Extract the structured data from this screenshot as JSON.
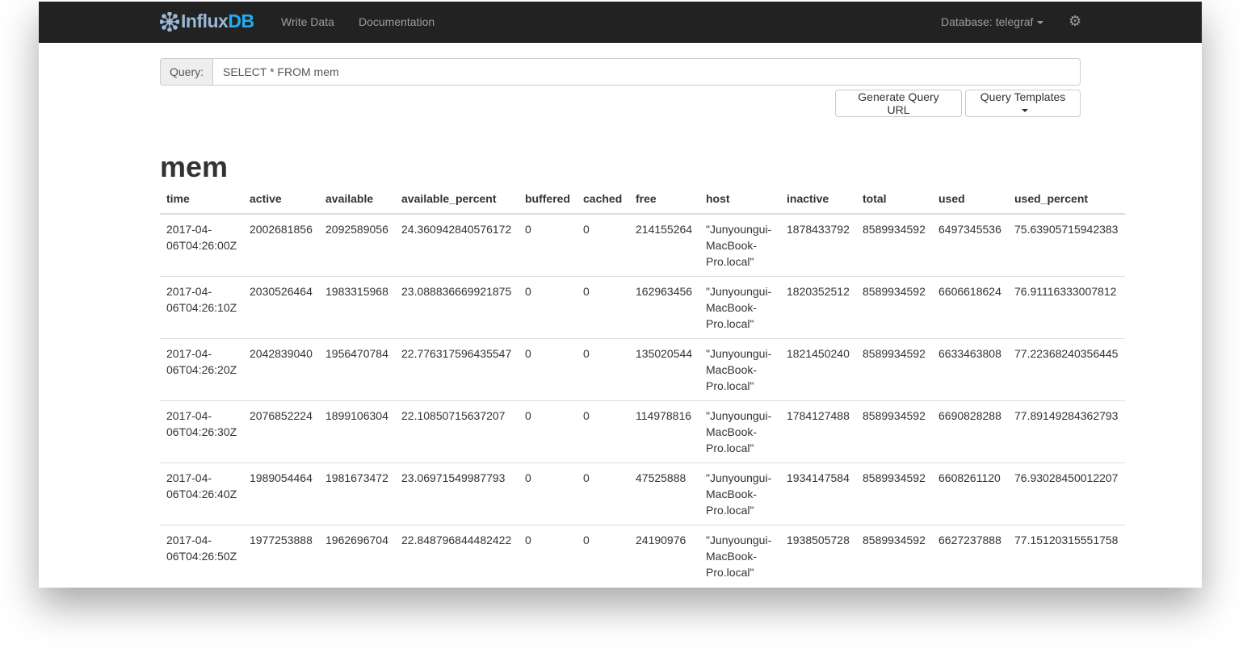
{
  "navbar": {
    "brand_a": "Influx",
    "brand_b": "DB",
    "links": [
      "Write Data",
      "Documentation"
    ],
    "database_label": "Database: telegraf",
    "settings_icon": "gear-icon"
  },
  "query": {
    "label": "Query:",
    "value": "SELECT * FROM mem"
  },
  "buttons": {
    "generate_url": "Generate Query URL",
    "templates": "Query Templates"
  },
  "result": {
    "title": "mem",
    "columns": [
      "time",
      "active",
      "available",
      "available_percent",
      "buffered",
      "cached",
      "free",
      "host",
      "inactive",
      "total",
      "used",
      "used_percent"
    ],
    "rows": [
      [
        "2017-04-06T04:26:00Z",
        "2002681856",
        "2092589056",
        "24.360942840576172",
        "0",
        "0",
        "214155264",
        "\"Junyoungui-MacBook-Pro.local\"",
        "1878433792",
        "8589934592",
        "6497345536",
        "75.63905715942383"
      ],
      [
        "2017-04-06T04:26:10Z",
        "2030526464",
        "1983315968",
        "23.088836669921875",
        "0",
        "0",
        "162963456",
        "\"Junyoungui-MacBook-Pro.local\"",
        "1820352512",
        "8589934592",
        "6606618624",
        "76.91116333007812"
      ],
      [
        "2017-04-06T04:26:20Z",
        "2042839040",
        "1956470784",
        "22.776317596435547",
        "0",
        "0",
        "135020544",
        "\"Junyoungui-MacBook-Pro.local\"",
        "1821450240",
        "8589934592",
        "6633463808",
        "77.22368240356445"
      ],
      [
        "2017-04-06T04:26:30Z",
        "2076852224",
        "1899106304",
        "22.10850715637207",
        "0",
        "0",
        "114978816",
        "\"Junyoungui-MacBook-Pro.local\"",
        "1784127488",
        "8589934592",
        "6690828288",
        "77.89149284362793"
      ],
      [
        "2017-04-06T04:26:40Z",
        "1989054464",
        "1981673472",
        "23.06971549987793",
        "0",
        "0",
        "47525888",
        "\"Junyoungui-MacBook-Pro.local\"",
        "1934147584",
        "8589934592",
        "6608261120",
        "76.93028450012207"
      ],
      [
        "2017-04-06T04:26:50Z",
        "1977253888",
        "1962696704",
        "22.848796844482422",
        "0",
        "0",
        "24190976",
        "\"Junyoungui-MacBook-Pro.local\"",
        "1938505728",
        "8589934592",
        "6627237888",
        "77.15120315551758"
      ]
    ]
  }
}
